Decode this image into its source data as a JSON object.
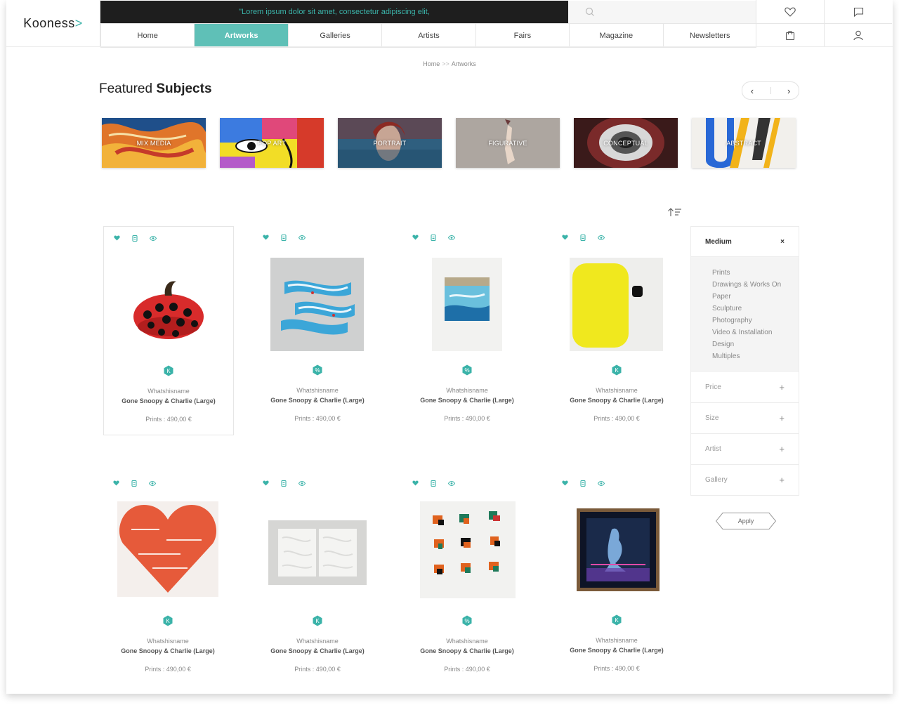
{
  "header": {
    "logo": "Kooness",
    "promo": "\"Lorem ipsum dolor sit amet, consectetur adipiscing elit,",
    "nav": [
      "Home",
      "Artworks",
      "Galleries",
      "Artists",
      "Fairs",
      "Magazine",
      "Newsletters"
    ],
    "active_nav": "Artworks"
  },
  "breadcrumb": {
    "home": "Home",
    "current": "Artworks"
  },
  "featured": {
    "title_light": "Featured",
    "title_bold": "Subjects",
    "subjects": [
      "MIX MEDIA",
      "POP ART",
      "PORTRAIT",
      "FIGURATIVE",
      "CONCEPTUAL",
      "ABSTRACT"
    ]
  },
  "artworks": [
    {
      "artist": "Whatshisname",
      "title": "Gone Snoopy & Charlie (Large)",
      "price": "Prints : 490,00 €"
    },
    {
      "artist": "Whatshisname",
      "title": "Gone Snoopy & Charlie (Large)",
      "price": "Prints : 490,00 €"
    },
    {
      "artist": "Whatshisname",
      "title": "Gone Snoopy & Charlie (Large)",
      "price": "Prints : 490,00 €"
    },
    {
      "artist": "Whatshisname",
      "title": "Gone Snoopy & Charlie (Large)",
      "price": "Prints : 490,00 €"
    },
    {
      "artist": "Whatshisname",
      "title": "Gone Snoopy & Charlie (Large)",
      "price": "Prints : 490,00 €"
    },
    {
      "artist": "Whatshisname",
      "title": "Gone Snoopy & Charlie (Large)",
      "price": "Prints : 490,00 €"
    },
    {
      "artist": "Whatshisname",
      "title": "Gone Snoopy & Charlie (Large)",
      "price": "Prints : 490,00 €"
    },
    {
      "artist": "Whatshisname",
      "title": "Gone Snoopy & Charlie (Large)",
      "price": "Prints : 490,00 €"
    }
  ],
  "filter": {
    "medium_label": "Medium",
    "medium_options": [
      "Prints",
      "Drawings & Works On",
      "Paper",
      "Sculpture",
      "Photography",
      "Video & Installation",
      "Design",
      "Multiples"
    ],
    "sections": [
      "Price",
      "Size",
      "Artist",
      "Gallery"
    ],
    "apply_label": "Apply"
  },
  "colors": {
    "accent": "#5fc0b7",
    "promo_bg": "#1e1e1e"
  }
}
